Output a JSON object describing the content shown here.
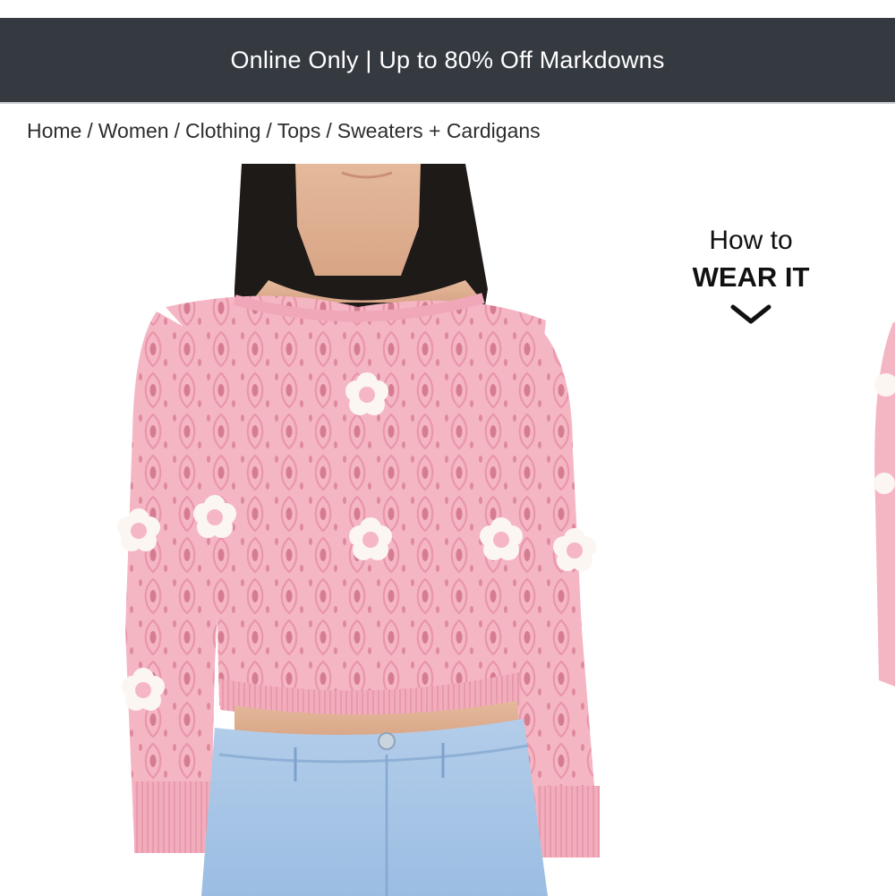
{
  "promo": {
    "text": "Online Only | Up to 80% Off Markdowns"
  },
  "breadcrumb": {
    "items": [
      "Home",
      "Women",
      "Clothing",
      "Tops",
      "Sweaters + Cardigans"
    ],
    "separator": "/"
  },
  "how_to": {
    "line1": "How to",
    "line2": "WEAR IT",
    "icon": "chevron-down-icon"
  },
  "colors": {
    "banner_bg": "#353a41",
    "banner_text": "#ffffff",
    "sweater_pink": "#f4b3c2",
    "denim_blue": "#a9c6e6"
  }
}
